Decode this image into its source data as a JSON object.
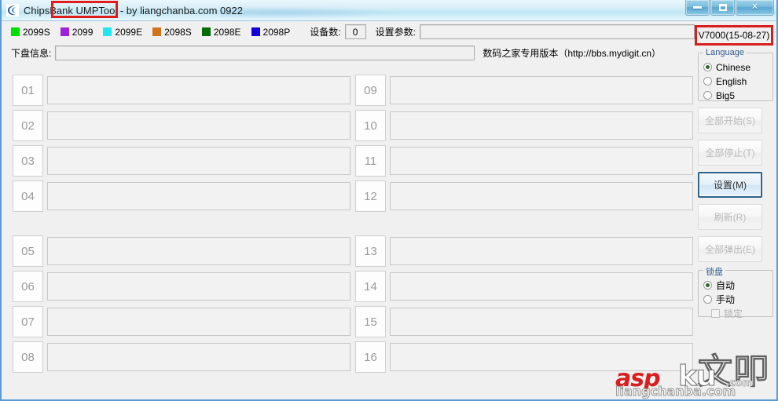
{
  "window": {
    "title": "ChipsBank UMPTool - by liangchanba.com 0922",
    "title_highlight": "UMPTool -",
    "app_icon": "chipsbank-logo-icon",
    "controls": {
      "minimize": "minimize-icon",
      "maximize": "maximize-icon",
      "close": "✕"
    }
  },
  "toolbar": {
    "legend": [
      {
        "label": "2099S",
        "color": "#00e000"
      },
      {
        "label": "2099",
        "color": "#9d23d8"
      },
      {
        "label": "2099E",
        "color": "#1ee8f0"
      },
      {
        "label": "2098S",
        "color": "#d2731c"
      },
      {
        "label": "2098E",
        "color": "#046b06"
      },
      {
        "label": "2098P",
        "color": "#1000d8"
      }
    ],
    "device_count_label": "设备数:",
    "device_count_value": "0",
    "param_label": "设置参数:",
    "param_value": ""
  },
  "info_row": {
    "label": "下盘信息:",
    "value": "",
    "note": "数码之家专用版本（http://bbs.mydigit.cn）"
  },
  "version": {
    "text": "V7000(15-08-27)",
    "highlight_color": "#d81f1f"
  },
  "slots": {
    "left": [
      "01",
      "02",
      "03",
      "04",
      "05",
      "06",
      "07",
      "08"
    ],
    "right": [
      "09",
      "10",
      "11",
      "12",
      "13",
      "14",
      "15",
      "16"
    ],
    "values": [
      "",
      "",
      "",
      "",
      "",
      "",
      "",
      "",
      "",
      "",
      "",
      "",
      "",
      "",
      "",
      ""
    ]
  },
  "language_group": {
    "title": "Language",
    "options": [
      {
        "label": "Chinese",
        "selected": true
      },
      {
        "label": "English",
        "selected": false
      },
      {
        "label": "Big5",
        "selected": false
      }
    ]
  },
  "action_buttons": [
    {
      "label": "全部开始(S)",
      "enabled": false,
      "focused": false
    },
    {
      "label": "全部停止(T)",
      "enabled": false,
      "focused": false
    },
    {
      "label": "设置(M)",
      "enabled": true,
      "focused": true
    },
    {
      "label": "刷新(R)",
      "enabled": false,
      "focused": false
    },
    {
      "label": "全部弹出(E)",
      "enabled": false,
      "focused": false
    }
  ],
  "lock_group": {
    "title": "锁盘",
    "options": [
      {
        "label": "自动",
        "selected": true
      },
      {
        "label": "手动",
        "selected": false
      }
    ],
    "checkbox": {
      "label": "锁定",
      "checked": false,
      "enabled": false
    }
  },
  "watermark": {
    "cn": "文叩",
    "asp": "asp",
    "ku": "ku",
    "dom": ".com",
    "lcb": "liangchanba.com"
  }
}
